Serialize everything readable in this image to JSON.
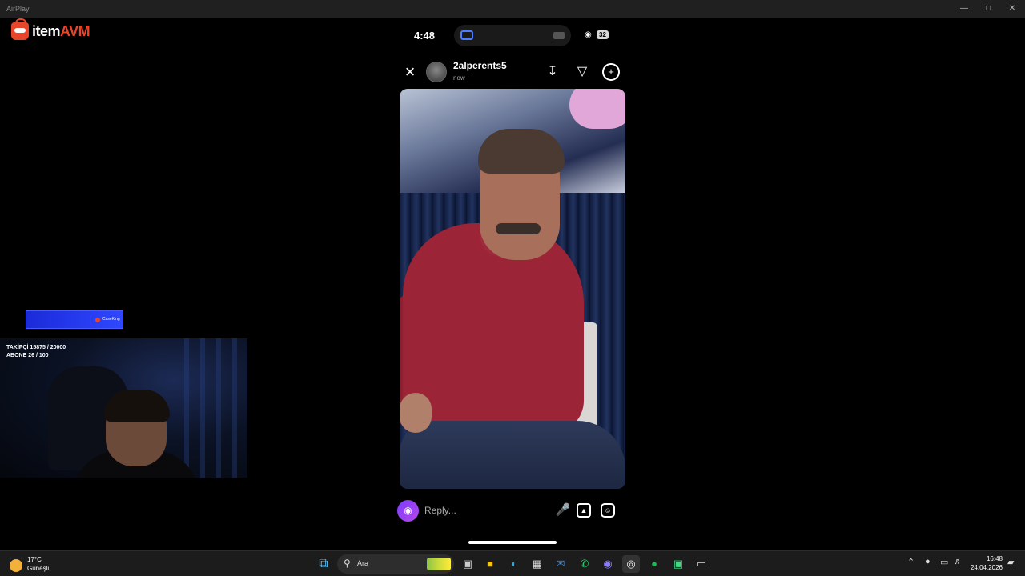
{
  "window": {
    "title": "AirPlay"
  },
  "overlay": {
    "logo_main": "item",
    "logo_accent": "AVM",
    "banner_text": "CaseKing",
    "stats": [
      "TAKİPÇİ 15875 / 20000",
      "ABONE 26 / 100"
    ]
  },
  "phone": {
    "status": {
      "time": "4:48",
      "battery": "32"
    },
    "story": {
      "username": "2alperents5",
      "time_ago": "now"
    },
    "reply": {
      "placeholder": "Reply..."
    }
  },
  "taskbar": {
    "weather": {
      "temp": "17°C",
      "condition": "Güneşli"
    },
    "search": {
      "placeholder": "Ara"
    },
    "clock": {
      "time": "16:48",
      "date": "24.04.2026"
    }
  }
}
